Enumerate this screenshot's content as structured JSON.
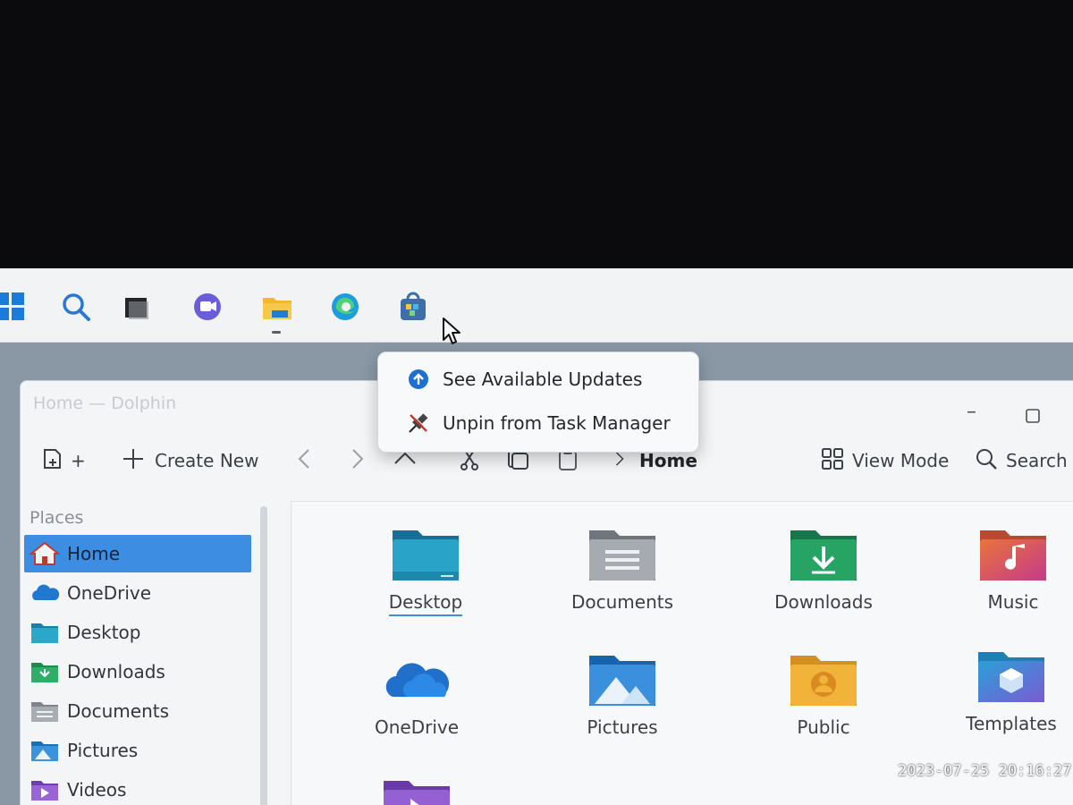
{
  "taskbar": {
    "icons": [
      "start-icon",
      "search-icon",
      "task-view-icon",
      "chat-icon",
      "file-explorer-icon",
      "edge-icon",
      "store-icon"
    ]
  },
  "context_menu": {
    "items": [
      {
        "label": "See Available Updates",
        "icon": "update-arrow-icon"
      },
      {
        "label": "Unpin from Task Manager",
        "icon": "unpin-icon"
      }
    ]
  },
  "window": {
    "title": "Home — Dolphin",
    "toolbar": {
      "new_tab_label": "+",
      "create_new_label": "Create New",
      "breadcrumb_current": "Home",
      "view_mode_label": "View Mode",
      "search_label": "Search"
    },
    "sidebar": {
      "section_label": "Places",
      "items": [
        {
          "label": "Home"
        },
        {
          "label": "OneDrive"
        },
        {
          "label": "Desktop"
        },
        {
          "label": "Downloads"
        },
        {
          "label": "Documents"
        },
        {
          "label": "Pictures"
        },
        {
          "label": "Videos"
        }
      ]
    },
    "content": {
      "items": [
        {
          "label": "Desktop"
        },
        {
          "label": "Documents"
        },
        {
          "label": "Downloads"
        },
        {
          "label": "Music"
        },
        {
          "label": "OneDrive"
        },
        {
          "label": "Pictures"
        },
        {
          "label": "Public"
        },
        {
          "label": "Templates"
        }
      ]
    }
  },
  "photo": {
    "timestamp": "2023-07-25 20:16:27"
  },
  "colors": {
    "accent": "#3d8ee2",
    "taskbar_bg": "#f1f3f5"
  }
}
